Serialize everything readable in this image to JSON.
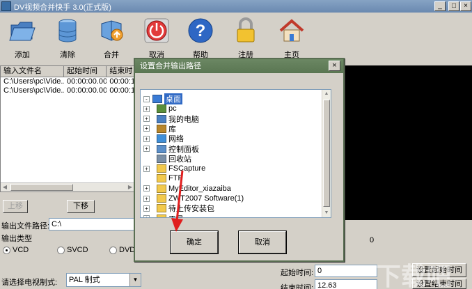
{
  "window": {
    "title": "DV视频合并快手 3.0(正式版)"
  },
  "toolbar": [
    {
      "label": "添加",
      "icon": "folder-icon"
    },
    {
      "label": "清除",
      "icon": "database-icon"
    },
    {
      "label": "合并",
      "icon": "merge-icon"
    },
    {
      "label": "取消",
      "icon": "cancel-icon"
    },
    {
      "label": "帮助",
      "icon": "help-icon"
    },
    {
      "label": "注册",
      "icon": "lock-icon"
    },
    {
      "label": "主页",
      "icon": "home-icon"
    }
  ],
  "filelist": {
    "headers": [
      "输入文件名",
      "起始时间",
      "结束时"
    ],
    "rows": [
      [
        "C:\\Users\\pc\\Vide...",
        "00:00:00.00",
        "00:00:1"
      ],
      [
        "C:\\Users\\pc\\Vide...",
        "00:00:00.00",
        "00:00:1"
      ]
    ]
  },
  "buttons": {
    "move_up": "上移",
    "move_down": "下移",
    "set_start": "设置起始时间",
    "set_end": "设置结束时间"
  },
  "output": {
    "path_label": "输出文件路径:",
    "path_value": "C:\\",
    "type_label": "输出类型",
    "types": [
      "VCD",
      "SVCD",
      "DVD"
    ],
    "selected_type": "VCD"
  },
  "tv": {
    "label": "请选择电视制式:",
    "value": "PAL 制式"
  },
  "right": {
    "counter": "0",
    "start_label": "起始时间:",
    "start_value": "0",
    "end_label": "结束时间:",
    "end_value": "12.63"
  },
  "dialog": {
    "title": "设置合并输出路径",
    "close": "×",
    "tree": [
      {
        "label": "桌面",
        "level": 0,
        "expander": "-",
        "icon": "desktop-icon",
        "selected": true
      },
      {
        "label": "pc",
        "level": 1,
        "expander": "+",
        "icon": "user-icon"
      },
      {
        "label": "我的电脑",
        "level": 1,
        "expander": "+",
        "icon": "computer-icon"
      },
      {
        "label": "库",
        "level": 1,
        "expander": "+",
        "icon": "library-icon"
      },
      {
        "label": "网络",
        "level": 1,
        "expander": "+",
        "icon": "network-icon"
      },
      {
        "label": "控制面板",
        "level": 1,
        "expander": "+",
        "icon": "control-panel-icon"
      },
      {
        "label": "回收站",
        "level": 1,
        "expander": "",
        "icon": "recycle-bin-icon"
      },
      {
        "label": "FSCapture",
        "level": 1,
        "expander": "+",
        "icon": "folder-icon"
      },
      {
        "label": "FTP",
        "level": 1,
        "expander": "",
        "icon": "folder-icon"
      },
      {
        "label": "MyEditor_xiazaiba",
        "level": 1,
        "expander": "+",
        "icon": "folder-icon"
      },
      {
        "label": "ZWT2007 Software(1)",
        "level": 1,
        "expander": "+",
        "icon": "folder-icon"
      },
      {
        "label": "待上传安装包",
        "level": 1,
        "expander": "+",
        "icon": "folder-icon"
      },
      {
        "label": "工具",
        "level": 1,
        "expander": "+",
        "icon": "folder-icon"
      }
    ],
    "ok": "确定",
    "cancel": "取消"
  },
  "watermark": "下载吧",
  "colors": {
    "dialog_title": "#5a7652",
    "selection": "#316ac5",
    "arrow": "#e01e1e"
  }
}
